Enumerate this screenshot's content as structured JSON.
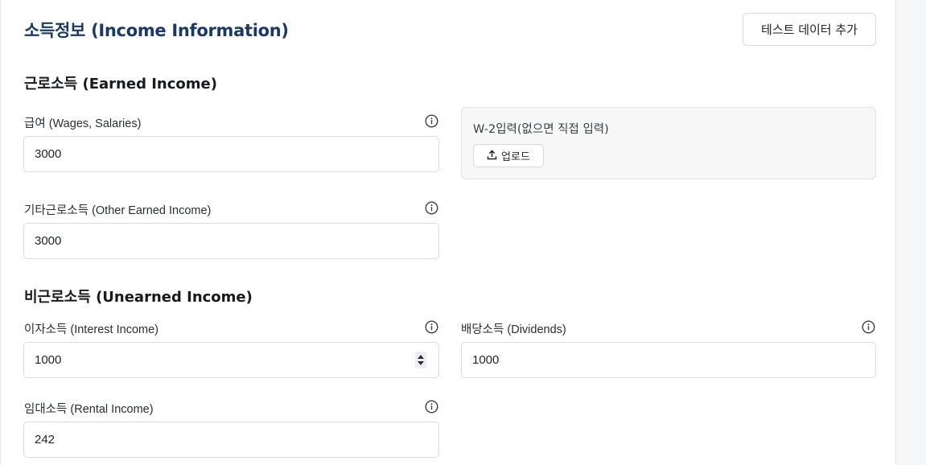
{
  "header": {
    "title": "소득정보 (Income Information)",
    "test_data_button": "테스트 데이터 추가"
  },
  "earned": {
    "section_title": "근로소득 (Earned Income)",
    "wages": {
      "label": "급여 (Wages, Salaries)",
      "value": "3000"
    },
    "other": {
      "label": "기타근로소득 (Other Earned Income)",
      "value": "3000"
    },
    "w2": {
      "label": "W-2입력(없으면 직접 입력)",
      "upload_button": "업로드"
    }
  },
  "unearned": {
    "section_title": "비근로소득 (Unearned Income)",
    "interest": {
      "label": "이자소득 (Interest Income)",
      "value": "1000"
    },
    "dividends": {
      "label": "배당소득 (Dividends)",
      "value": "1000"
    },
    "rental": {
      "label": "임대소득 (Rental Income)",
      "value": "242"
    }
  },
  "icons": {
    "info": "info-circle-icon",
    "upload": "upload-icon",
    "stepper_up": "caret-up-icon",
    "stepper_down": "caret-down-icon"
  },
  "colors": {
    "title": "#1a3a63",
    "border": "#d9dce1",
    "w2_background": "#f7f7f8"
  }
}
